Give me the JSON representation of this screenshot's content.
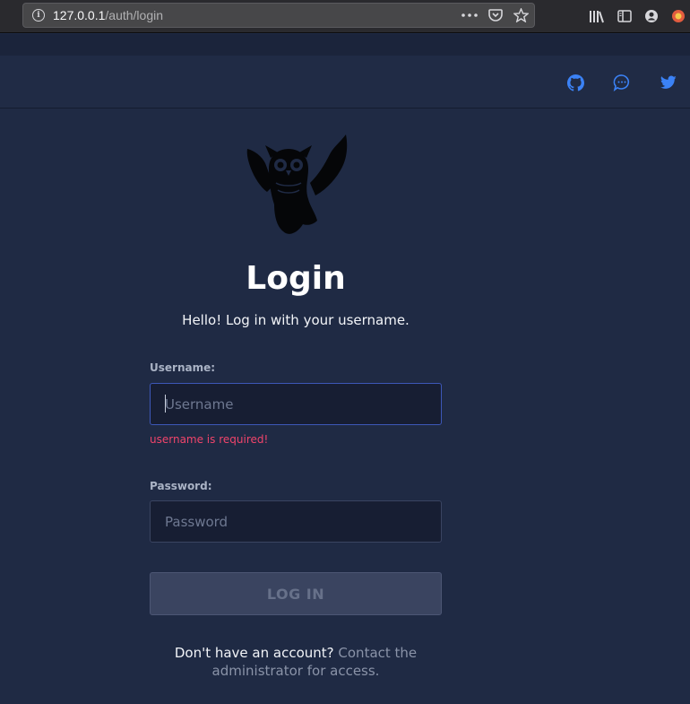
{
  "browser": {
    "url_host": "127.0.0.1",
    "url_path": "/auth/login",
    "icons": [
      "info-icon",
      "more-icon",
      "pocket-icon",
      "bookmark-star-icon",
      "library-icon",
      "sidebar-icon",
      "account-icon",
      "extension-icon"
    ]
  },
  "header": {
    "icons": [
      "github-icon",
      "chat-icon",
      "twitter-icon"
    ],
    "accent_color": "#3b82f6"
  },
  "login": {
    "title": "Login",
    "subtitle": "Hello! Log in with your username.",
    "username_label": "Username:",
    "username_placeholder": "Username",
    "username_error": "username is required!",
    "password_label": "Password:",
    "password_placeholder": "Password",
    "submit_label": "LOG IN",
    "footer_prefix": "Don't have an account?",
    "footer_link": "Contact the administrator for access."
  },
  "colors": {
    "background": "#1f2a44",
    "error": "#f0446b"
  }
}
